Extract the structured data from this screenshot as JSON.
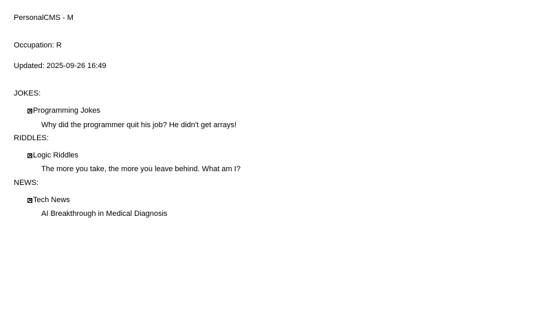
{
  "header": {
    "title": "PersonalCMS - M",
    "occupation": "Occupation: R",
    "updated": "Updated: 2025-09-26 16:49"
  },
  "sections": {
    "jokes": {
      "label": "JOKES:",
      "group_title": "Programming Jokes",
      "items": [
        "Why did the programmer quit his job? He didn't get arrays!"
      ]
    },
    "riddles": {
      "label": "RIDDLES:",
      "group_title": "Logic Riddles",
      "items": [
        "The more you take, the more you leave behind. What am I?"
      ]
    },
    "news": {
      "label": "NEWS:",
      "group_title": "Tech News",
      "items": [
        "AI Breakthrough in Medical Diagnosis"
      ]
    }
  },
  "icons": {
    "group_toggle": "x-box-icon"
  }
}
